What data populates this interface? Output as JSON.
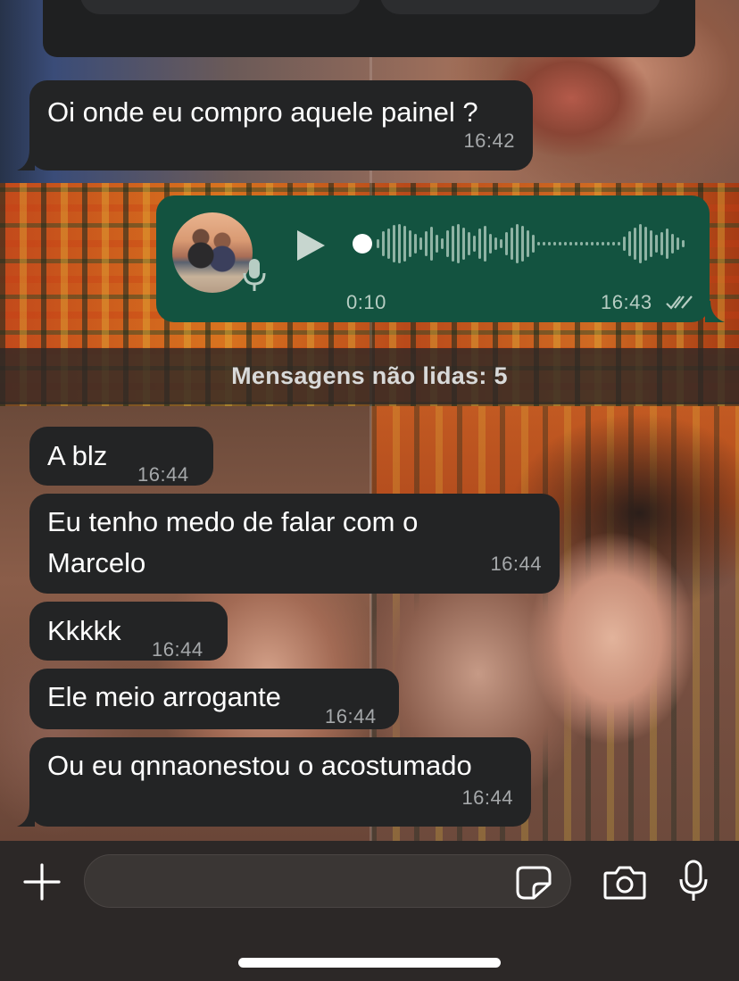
{
  "colors": {
    "incoming_bubble": "#232425",
    "outgoing_bubble": "#135340",
    "timestamp": "#a5a8aa",
    "composer_bg": "#2c2827"
  },
  "previous_message": {
    "text": "Oi onde eu compro aquele painel ?",
    "time": "16:42"
  },
  "voice_message": {
    "duration": "0:10",
    "time": "16:43",
    "status": "read",
    "avatar_icon": "contact-photo",
    "play_icon": "play-icon",
    "mic_icon": "microphone-icon"
  },
  "unread_banner": "Mensagens não lidas: 5",
  "messages": [
    {
      "text": "A blz",
      "time": "16:44"
    },
    {
      "text": "Eu tenho medo de falar com o Marcelo",
      "time": "16:44"
    },
    {
      "text": "Kkkkk",
      "time": "16:44"
    },
    {
      "text": "Ele meio arrogante",
      "time": "16:44"
    },
    {
      "text": "Ou eu qnnaonestou o acostumado",
      "time": "16:44"
    }
  ],
  "composer": {
    "input_value": "",
    "icons": [
      "plus-icon",
      "sticker-icon",
      "camera-icon",
      "microphone-icon"
    ]
  }
}
